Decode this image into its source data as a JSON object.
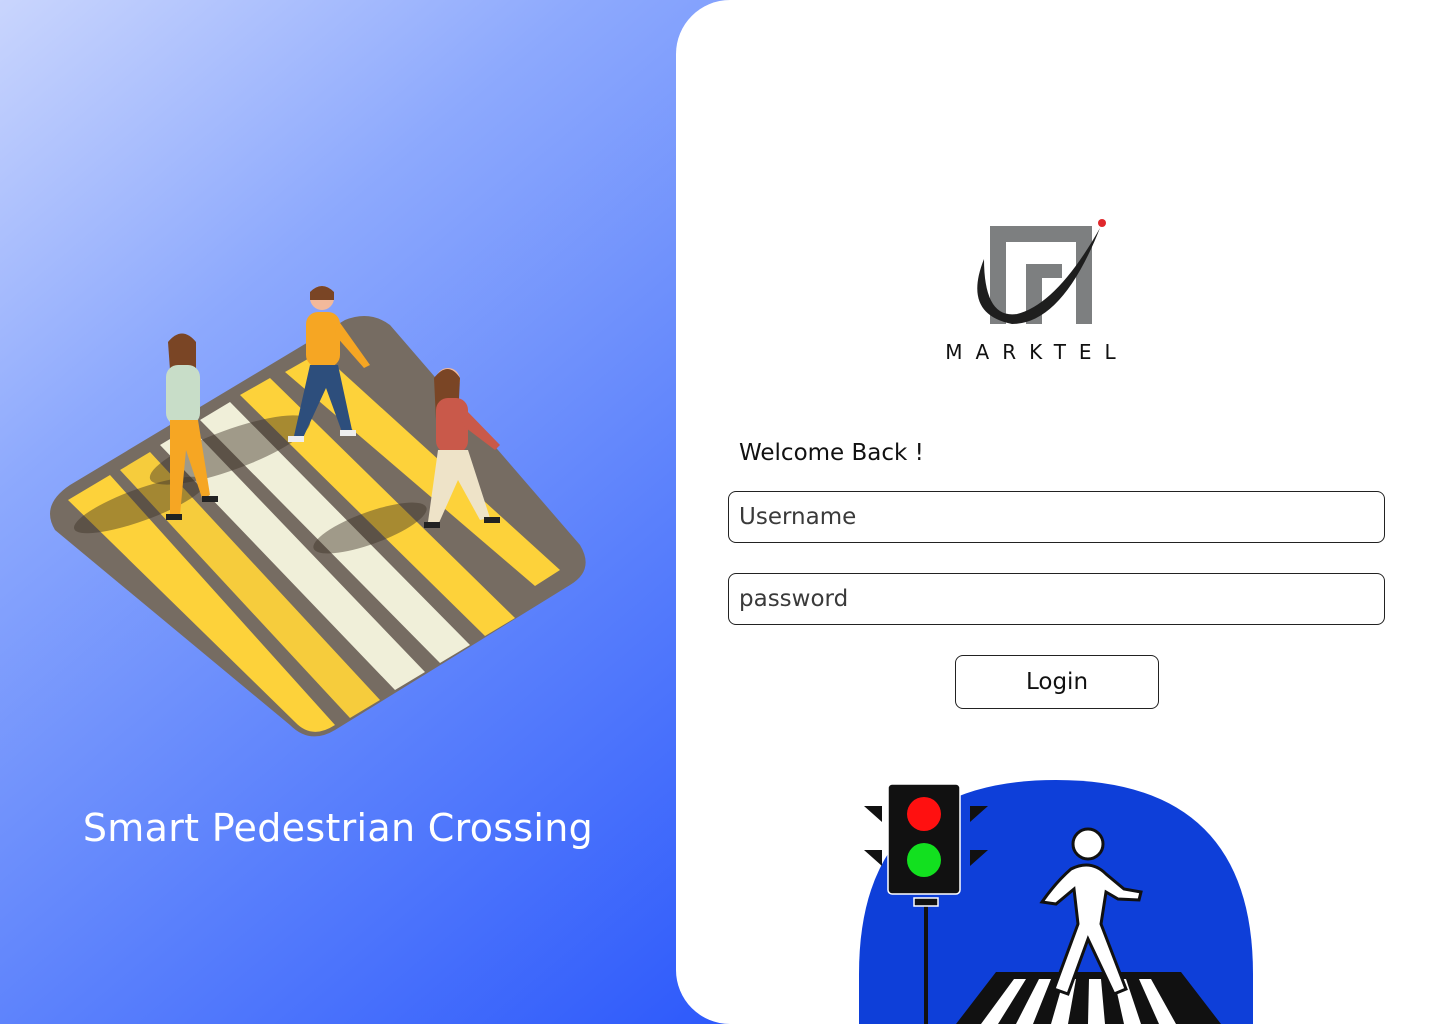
{
  "left_panel": {
    "tagline": "Smart Pedestrian Crossing"
  },
  "brand": {
    "logo_text": "MARKTEL",
    "accent_color": "#e0282c",
    "logo_gray": "#7d7f80"
  },
  "login": {
    "welcome": "Welcome Back !",
    "username_placeholder": "Username",
    "password_placeholder": "password",
    "login_label": "Login"
  },
  "colors": {
    "gradient_start": "#c9d5fd",
    "gradient_end": "#0f3ffa",
    "sign_blue": "#0e3fd9",
    "light_red": "#ff1010",
    "light_green": "#12e01f"
  }
}
